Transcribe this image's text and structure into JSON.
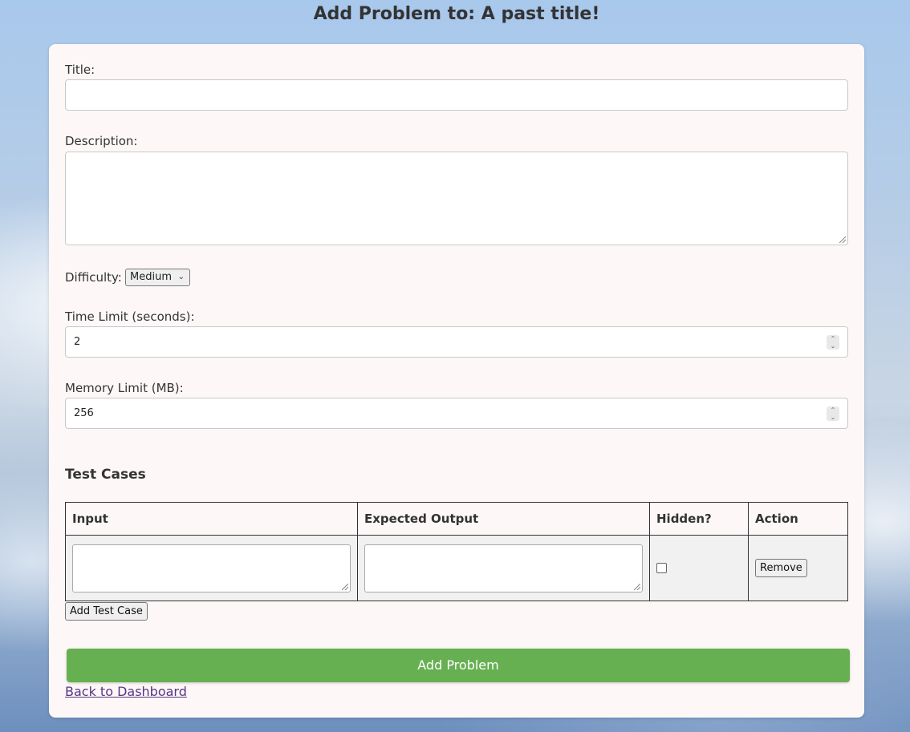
{
  "page": {
    "title": "Add Problem to: A past title!"
  },
  "form": {
    "title_label": "Title:",
    "title_value": "",
    "description_label": "Description:",
    "description_value": "",
    "difficulty_label": "Difficulty:",
    "difficulty_value": "Medium",
    "time_limit_label": "Time Limit (seconds):",
    "time_limit_value": "2",
    "memory_limit_label": "Memory Limit (MB):",
    "memory_limit_value": "256"
  },
  "test_cases": {
    "heading": "Test Cases",
    "columns": [
      "Input",
      "Expected Output",
      "Hidden?",
      "Action"
    ],
    "rows": [
      {
        "input": "",
        "expected_output": "",
        "hidden": false,
        "action_label": "Remove"
      }
    ],
    "add_label": "Add Test Case"
  },
  "actions": {
    "submit_label": "Add Problem",
    "back_label": "Back to Dashboard"
  },
  "colors": {
    "submit_bg": "#67b052",
    "link": "#5a3585",
    "card_bg": "#fdf8f7"
  },
  "icons": {
    "select": "chevron-down-icon",
    "spinner": "spinner-arrows-icon"
  }
}
